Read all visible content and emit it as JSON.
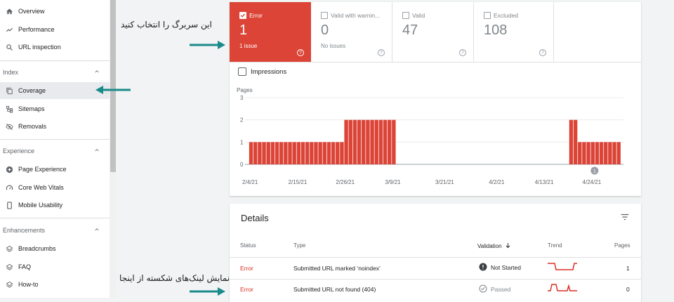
{
  "sidebar": {
    "top_items": [
      {
        "label": "Overview"
      },
      {
        "label": "Performance"
      },
      {
        "label": "URL inspection"
      }
    ],
    "index_section": "Index",
    "index_items": [
      {
        "label": "Coverage"
      },
      {
        "label": "Sitemaps"
      },
      {
        "label": "Removals"
      }
    ],
    "experience_section": "Experience",
    "experience_items": [
      {
        "label": "Page Experience"
      },
      {
        "label": "Core Web Vitals"
      },
      {
        "label": "Mobile Usability"
      }
    ],
    "enhancements_section": "Enhancements",
    "enhancements_items": [
      {
        "label": "Breadcrumbs"
      },
      {
        "label": "FAQ"
      },
      {
        "label": "How-to"
      }
    ]
  },
  "annotations": {
    "select_tab": "این سربرگ را انتخاب کنید",
    "broken_links": "نمایش لینک‌های شکسته از اینجا"
  },
  "stats": [
    {
      "label": "Error",
      "value": "1",
      "sub": "1 issue",
      "checked": true
    },
    {
      "label": "Valid with warnin...",
      "value": "0",
      "sub": "No issues",
      "checked": false
    },
    {
      "label": "Valid",
      "value": "47",
      "sub": "",
      "checked": false
    },
    {
      "label": "Excluded",
      "value": "108",
      "sub": "",
      "checked": false
    }
  ],
  "impressions_label": "Impressions",
  "chart_data": {
    "type": "bar",
    "ylabel": "Pages",
    "ylim": [
      0,
      3
    ],
    "yticks": [
      "0",
      "1",
      "2",
      "3"
    ],
    "xticks": [
      "2/4/21",
      "2/15/21",
      "2/26/21",
      "3/9/21",
      "3/21/21",
      "4/2/21",
      "4/13/21",
      "4/24/21"
    ],
    "annotation_marker": "1",
    "series": [
      {
        "color": "#db4437",
        "segments": [
          {
            "start": "2/4/21",
            "end": "2/25/21",
            "value": 1
          },
          {
            "start": "2/26/21",
            "end": "3/9/21",
            "value": 2
          },
          {
            "start": "4/19/21",
            "end": "4/20/21",
            "value": 2
          },
          {
            "start": "4/21/21",
            "end": "4/30/21",
            "value": 1
          }
        ]
      }
    ]
  },
  "details": {
    "title": "Details",
    "columns": {
      "status": "Status",
      "type": "Type",
      "validation": "Validation",
      "trend": "Trend",
      "pages": "Pages"
    },
    "rows": [
      {
        "status": "Error",
        "type": "Submitted URL marked ‘noindex’",
        "validation": "Not Started",
        "pages": "1"
      },
      {
        "status": "Error",
        "type": "Submitted URL not found (404)",
        "validation": "Passed",
        "pages": "0"
      }
    ]
  },
  "colors": {
    "error": "#db4437",
    "arrow": "#1a8a8a"
  }
}
